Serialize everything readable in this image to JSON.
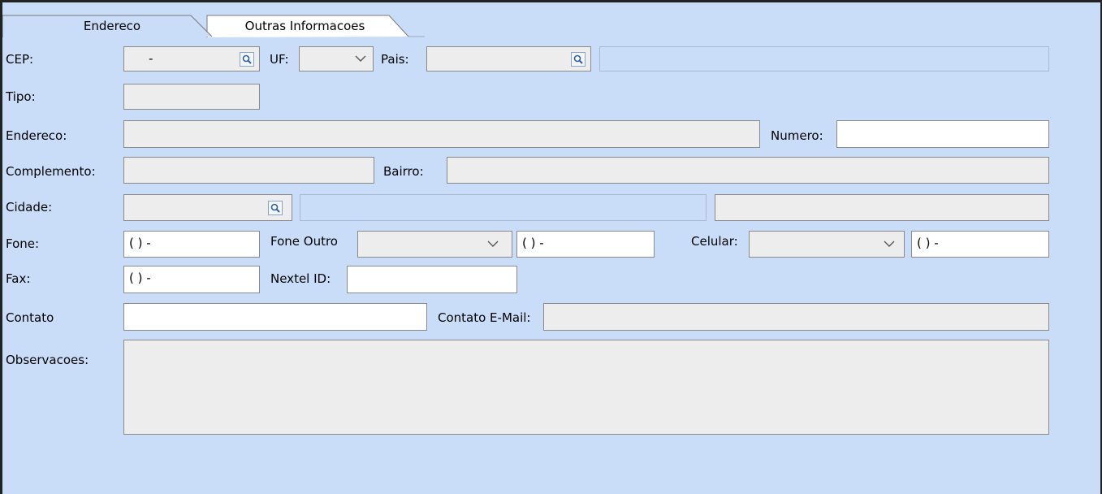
{
  "tabs": [
    {
      "label": "Endereco",
      "active": true
    },
    {
      "label": "Outras Informacoes",
      "active": false
    }
  ],
  "labels": {
    "cep": "CEP:",
    "uf": "UF:",
    "pais": "Pais:",
    "tipo": "Tipo:",
    "endereco": "Endereco:",
    "numero": "Numero:",
    "complemento": "Complemento:",
    "bairro": "Bairro:",
    "cidade": "Cidade:",
    "fone": "Fone:",
    "fone_outro": "Fone Outro",
    "celular": "Celular:",
    "fax": "Fax:",
    "nextel": "Nextel ID:",
    "contato": "Contato",
    "contato_email": "Contato E-Mail:",
    "observacoes": "Observacoes:"
  },
  "values": {
    "cep": "-",
    "uf": "",
    "pais": "",
    "pais_nome": "",
    "tipo": "",
    "endereco": "",
    "numero": "",
    "complemento": "",
    "bairro": "",
    "cidade": "",
    "cidade_nome": "",
    "cidade_extra": "",
    "fone": "( )    -",
    "fone_outro_tipo": "",
    "fone_outro": "( )    -",
    "celular_tipo": "",
    "celular": "( )    -",
    "fax": "( )    -",
    "nextel": "",
    "contato": "",
    "contato_email": "",
    "observacoes": ""
  },
  "icons": {
    "lookup": "magnifier-icon",
    "dropdown": "chevron-down-icon"
  },
  "colors": {
    "panel_bg": "#c9dcf8",
    "field_disabled": "#ededed",
    "field_enabled": "#ffffff"
  }
}
